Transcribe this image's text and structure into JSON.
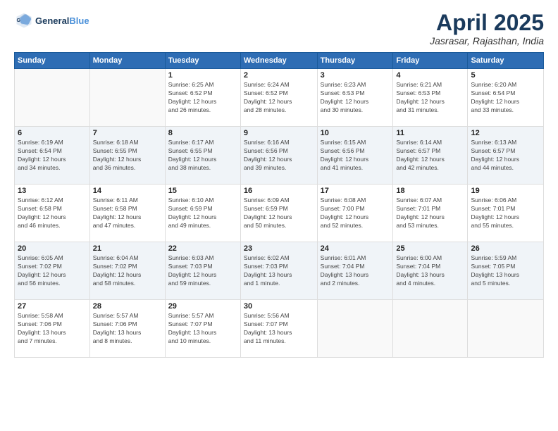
{
  "logo": {
    "line1": "General",
    "line2": "Blue"
  },
  "title": "April 2025",
  "location": "Jasrasar, Rajasthan, India",
  "weekdays": [
    "Sunday",
    "Monday",
    "Tuesday",
    "Wednesday",
    "Thursday",
    "Friday",
    "Saturday"
  ],
  "weeks": [
    [
      {
        "day": "",
        "detail": ""
      },
      {
        "day": "",
        "detail": ""
      },
      {
        "day": "1",
        "detail": "Sunrise: 6:25 AM\nSunset: 6:52 PM\nDaylight: 12 hours\nand 26 minutes."
      },
      {
        "day": "2",
        "detail": "Sunrise: 6:24 AM\nSunset: 6:52 PM\nDaylight: 12 hours\nand 28 minutes."
      },
      {
        "day": "3",
        "detail": "Sunrise: 6:23 AM\nSunset: 6:53 PM\nDaylight: 12 hours\nand 30 minutes."
      },
      {
        "day": "4",
        "detail": "Sunrise: 6:21 AM\nSunset: 6:53 PM\nDaylight: 12 hours\nand 31 minutes."
      },
      {
        "day": "5",
        "detail": "Sunrise: 6:20 AM\nSunset: 6:54 PM\nDaylight: 12 hours\nand 33 minutes."
      }
    ],
    [
      {
        "day": "6",
        "detail": "Sunrise: 6:19 AM\nSunset: 6:54 PM\nDaylight: 12 hours\nand 34 minutes."
      },
      {
        "day": "7",
        "detail": "Sunrise: 6:18 AM\nSunset: 6:55 PM\nDaylight: 12 hours\nand 36 minutes."
      },
      {
        "day": "8",
        "detail": "Sunrise: 6:17 AM\nSunset: 6:55 PM\nDaylight: 12 hours\nand 38 minutes."
      },
      {
        "day": "9",
        "detail": "Sunrise: 6:16 AM\nSunset: 6:56 PM\nDaylight: 12 hours\nand 39 minutes."
      },
      {
        "day": "10",
        "detail": "Sunrise: 6:15 AM\nSunset: 6:56 PM\nDaylight: 12 hours\nand 41 minutes."
      },
      {
        "day": "11",
        "detail": "Sunrise: 6:14 AM\nSunset: 6:57 PM\nDaylight: 12 hours\nand 42 minutes."
      },
      {
        "day": "12",
        "detail": "Sunrise: 6:13 AM\nSunset: 6:57 PM\nDaylight: 12 hours\nand 44 minutes."
      }
    ],
    [
      {
        "day": "13",
        "detail": "Sunrise: 6:12 AM\nSunset: 6:58 PM\nDaylight: 12 hours\nand 46 minutes."
      },
      {
        "day": "14",
        "detail": "Sunrise: 6:11 AM\nSunset: 6:58 PM\nDaylight: 12 hours\nand 47 minutes."
      },
      {
        "day": "15",
        "detail": "Sunrise: 6:10 AM\nSunset: 6:59 PM\nDaylight: 12 hours\nand 49 minutes."
      },
      {
        "day": "16",
        "detail": "Sunrise: 6:09 AM\nSunset: 6:59 PM\nDaylight: 12 hours\nand 50 minutes."
      },
      {
        "day": "17",
        "detail": "Sunrise: 6:08 AM\nSunset: 7:00 PM\nDaylight: 12 hours\nand 52 minutes."
      },
      {
        "day": "18",
        "detail": "Sunrise: 6:07 AM\nSunset: 7:01 PM\nDaylight: 12 hours\nand 53 minutes."
      },
      {
        "day": "19",
        "detail": "Sunrise: 6:06 AM\nSunset: 7:01 PM\nDaylight: 12 hours\nand 55 minutes."
      }
    ],
    [
      {
        "day": "20",
        "detail": "Sunrise: 6:05 AM\nSunset: 7:02 PM\nDaylight: 12 hours\nand 56 minutes."
      },
      {
        "day": "21",
        "detail": "Sunrise: 6:04 AM\nSunset: 7:02 PM\nDaylight: 12 hours\nand 58 minutes."
      },
      {
        "day": "22",
        "detail": "Sunrise: 6:03 AM\nSunset: 7:03 PM\nDaylight: 12 hours\nand 59 minutes."
      },
      {
        "day": "23",
        "detail": "Sunrise: 6:02 AM\nSunset: 7:03 PM\nDaylight: 13 hours\nand 1 minute."
      },
      {
        "day": "24",
        "detail": "Sunrise: 6:01 AM\nSunset: 7:04 PM\nDaylight: 13 hours\nand 2 minutes."
      },
      {
        "day": "25",
        "detail": "Sunrise: 6:00 AM\nSunset: 7:04 PM\nDaylight: 13 hours\nand 4 minutes."
      },
      {
        "day": "26",
        "detail": "Sunrise: 5:59 AM\nSunset: 7:05 PM\nDaylight: 13 hours\nand 5 minutes."
      }
    ],
    [
      {
        "day": "27",
        "detail": "Sunrise: 5:58 AM\nSunset: 7:06 PM\nDaylight: 13 hours\nand 7 minutes."
      },
      {
        "day": "28",
        "detail": "Sunrise: 5:57 AM\nSunset: 7:06 PM\nDaylight: 13 hours\nand 8 minutes."
      },
      {
        "day": "29",
        "detail": "Sunrise: 5:57 AM\nSunset: 7:07 PM\nDaylight: 13 hours\nand 10 minutes."
      },
      {
        "day": "30",
        "detail": "Sunrise: 5:56 AM\nSunset: 7:07 PM\nDaylight: 13 hours\nand 11 minutes."
      },
      {
        "day": "",
        "detail": ""
      },
      {
        "day": "",
        "detail": ""
      },
      {
        "day": "",
        "detail": ""
      }
    ]
  ]
}
